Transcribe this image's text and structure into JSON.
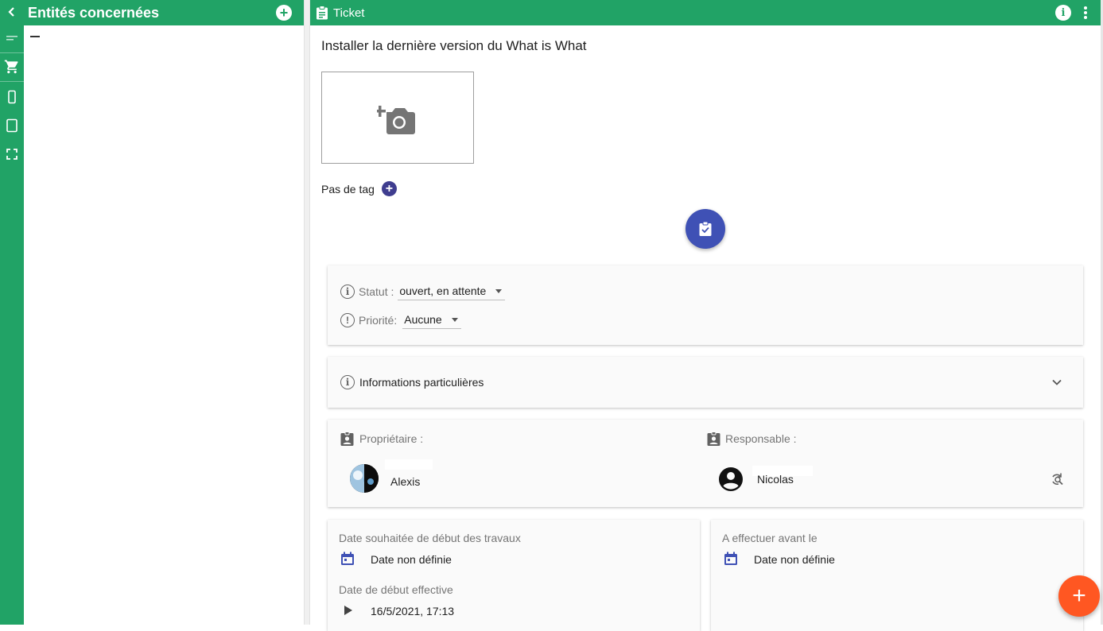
{
  "left_panel": {
    "title": "Entités concernées",
    "dash": "—"
  },
  "ticket_panel": {
    "header_title": "Ticket",
    "ticket_title": "Installer la dernière version du What is What",
    "tags_label": "Pas de tag"
  },
  "status_card": {
    "status_label": "Statut :",
    "status_value": "ouvert, en attente",
    "priority_label": "Priorité:",
    "priority_value": "Aucune"
  },
  "info_card": {
    "label": "Informations particulières"
  },
  "people_card": {
    "owner_label": "Propriétaire :",
    "owner_name": "Alexis",
    "responsible_label": "Responsable :",
    "responsible_name": "Nicolas"
  },
  "dates_left": {
    "wished_start_label": "Date souhaitée de début des travaux",
    "wished_start_value": "Date non définie",
    "effective_start_label": "Date de début effective",
    "effective_start_value": "16/5/2021, 17:13"
  },
  "dates_right": {
    "due_label": "A effectuer avant le",
    "due_value": "Date non définie"
  },
  "colors": {
    "primary_green": "#21a366",
    "indigo": "#3f51b5",
    "fab_orange": "#ff5722"
  }
}
